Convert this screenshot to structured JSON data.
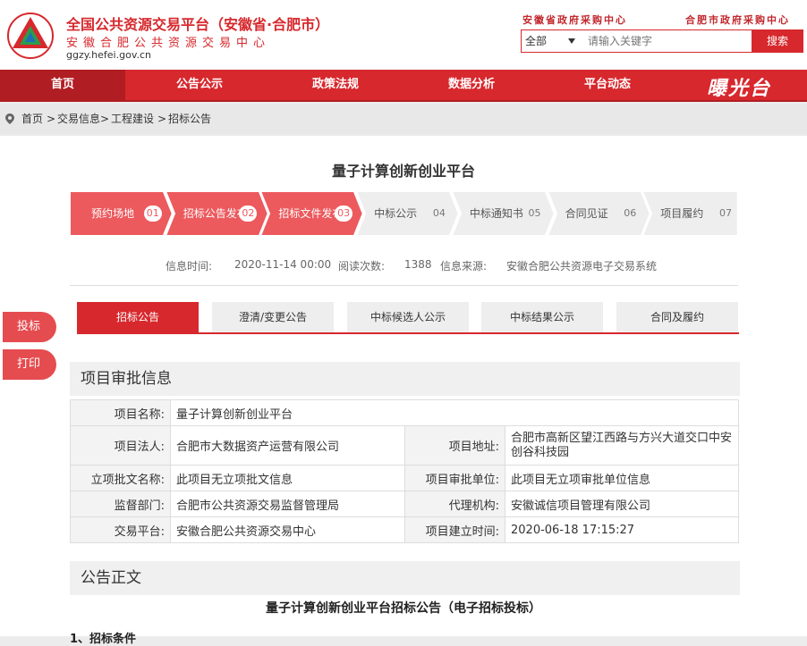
{
  "header": {
    "title": "全国公共资源交易平台（安徽省·合肥市）",
    "subtitle": "安徽合肥公共资源交易中心",
    "url": "ggzy.hefei.gov.cn",
    "top_links": [
      "安徽省政府采购中心",
      "合肥市政府采购中心"
    ],
    "search": {
      "scope": "全部",
      "placeholder": "请输入关键字",
      "button": "搜索"
    }
  },
  "nav": {
    "items": [
      "首页",
      "公告公示",
      "政策法规",
      "数据分析",
      "平台动态"
    ],
    "active": 0,
    "brand": "曝光台"
  },
  "breadcrumb": [
    "首页",
    "交易信息>",
    "工程建设",
    ">",
    "招标公告"
  ],
  "page": {
    "title": "量子计算创新创业平台",
    "steps": [
      {
        "label": "预约场地",
        "num": "01",
        "done": true
      },
      {
        "label": "招标公告发布",
        "num": "02",
        "done": true
      },
      {
        "label": "招标文件发布",
        "num": "03",
        "done": true
      },
      {
        "label": "中标公示",
        "num": "04",
        "done": false
      },
      {
        "label": "中标通知书",
        "num": "05",
        "done": false
      },
      {
        "label": "合同见证",
        "num": "06",
        "done": false
      },
      {
        "label": "项目履约",
        "num": "07",
        "done": false
      }
    ],
    "meta": {
      "time_label": "信息时间:",
      "time": "2020-11-14 00:00",
      "reads_label": "阅读次数:",
      "reads": "1388",
      "source_label": "信息来源:",
      "source": "安徽合肥公共资源电子交易系统"
    },
    "tabs": [
      "招标公告",
      "澄清/变更公告",
      "中标候选人公示",
      "中标结果公示",
      "合同及履约"
    ],
    "active_tab": 0,
    "side_buttons": [
      "投标",
      "打印"
    ],
    "approval_title": "项目审批信息",
    "approval": {
      "name_k": "项目名称:",
      "name_v": "量子计算创新创业平台",
      "legal_k": "项目法人:",
      "legal_v": "合肥市大数据资产运营有限公司",
      "addr_k": "项目地址:",
      "addr_v": "合肥市高新区望江西路与方兴大道交口中安创谷科技园",
      "doc_k": "立项批文名称:",
      "doc_v": "此项目无立项批文信息",
      "unit_k": "项目审批单位:",
      "unit_v": "此项目无立项审批单位信息",
      "sup_k": "监督部门:",
      "sup_v": "合肥市公共资源交易监督管理局",
      "agent_k": "代理机构:",
      "agent_v": "安徽诚信项目管理有限公司",
      "plat_k": "交易平台:",
      "plat_v": "安徽合肥公共资源交易中心",
      "created_k": "项目建立时间:",
      "created_v": "2020-06-18 17:15:27"
    },
    "notice_title": "公告正文",
    "doc_title": "量子计算创新创业平台招标公告（电子招标投标）",
    "doc_first_line": "1、招标条件"
  },
  "colors": {
    "accent": "#d7282d",
    "step_done": "#ec5a5e",
    "step_todo": "#eeeeee"
  }
}
